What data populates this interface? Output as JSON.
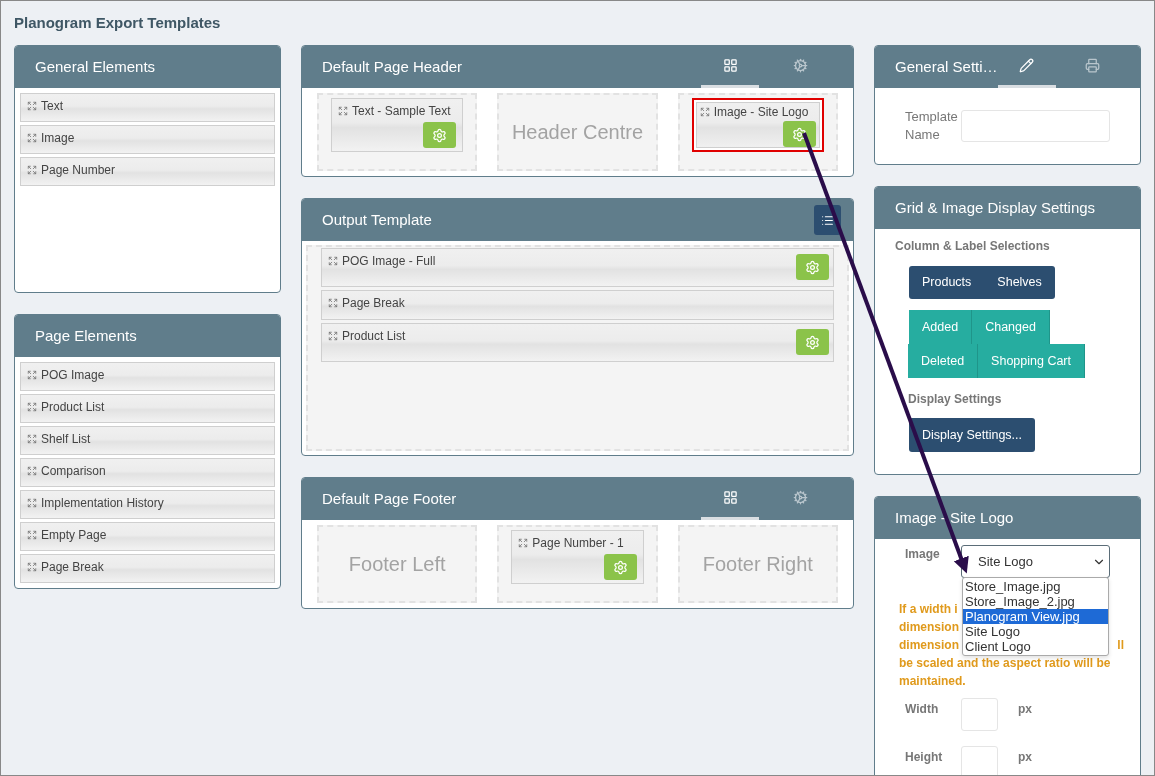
{
  "title": "Planogram Export Templates",
  "general_elements": {
    "title": "General Elements",
    "items": [
      "Text",
      "Image",
      "Page Number"
    ]
  },
  "page_elements": {
    "title": "Page Elements",
    "items": [
      "POG Image",
      "Product List",
      "Shelf List",
      "Comparison",
      "Implementation History",
      "Empty Page",
      "Page Break"
    ]
  },
  "page_header": {
    "title": "Default Page Header",
    "tabs": [
      {
        "kind": "grid",
        "selected": true
      },
      {
        "kind": "gear",
        "selected": false
      }
    ],
    "slots": [
      {
        "kind": "element",
        "label": "Text - Sample Text",
        "highlighted": false
      },
      {
        "kind": "placeholder",
        "label": "Header Centre"
      },
      {
        "kind": "element",
        "label": "Image - Site Logo",
        "highlighted": true
      }
    ]
  },
  "output_template": {
    "title": "Output Template",
    "items": [
      {
        "label": "POG Image - Full",
        "has_settings": true
      },
      {
        "label": "Page Break",
        "has_settings": false
      },
      {
        "label": "Product List",
        "has_settings": true
      }
    ]
  },
  "page_footer": {
    "title": "Default Page Footer",
    "tabs": [
      {
        "kind": "grid",
        "selected": true
      },
      {
        "kind": "gear",
        "selected": false
      }
    ],
    "slots": [
      {
        "kind": "placeholder",
        "label": "Footer Left"
      },
      {
        "kind": "element",
        "label": "Page Number - 1",
        "highlighted": false
      },
      {
        "kind": "placeholder",
        "label": "Footer Right"
      }
    ]
  },
  "general_settings": {
    "title": "General Setti…",
    "tabs": [
      {
        "kind": "pencil",
        "selected": true
      },
      {
        "kind": "printer",
        "selected": false
      }
    ],
    "field_label": "Template Name"
  },
  "grid_settings": {
    "title": "Grid & Image Display Settings",
    "section_label": "Column & Label Selections",
    "group_1": [
      "Products",
      "Shelves"
    ],
    "group_2": [
      [
        "Added",
        "Changed"
      ],
      [
        "Deleted",
        "Shopping Cart"
      ]
    ],
    "display_label": "Display Settings",
    "display_button": "Display Settings..."
  },
  "image_settings": {
    "title": "Image - Site Logo",
    "image_label": "Image",
    "selected_value": "Site Logo",
    "options": [
      {
        "label": "Store_Image.jpg",
        "selected": false
      },
      {
        "label": "Store_Image_2.jpg",
        "selected": false
      },
      {
        "label": "Planogram View.jpg",
        "selected": true
      },
      {
        "label": "Site Logo",
        "selected": false
      },
      {
        "label": "Client Logo",
        "selected": false
      }
    ],
    "note_lines": [
      {
        "left": "If a width i"
      },
      {
        "left": "dimension"
      },
      {
        "left": "dimension",
        "right": "ll"
      },
      {
        "left": "be scaled and the aspect ratio will be"
      },
      {
        "left": "maintained."
      }
    ],
    "width_label": "Width",
    "width_unit": "px",
    "height_label": "Height",
    "height_unit": "px"
  }
}
